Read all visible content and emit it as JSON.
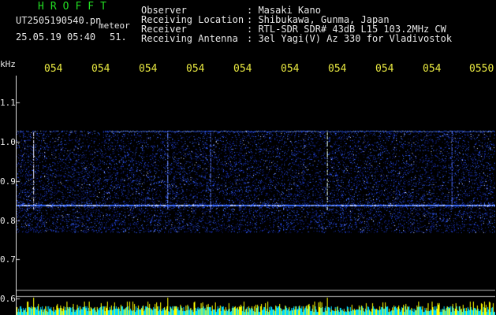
{
  "header": {
    "title": "HROFFT",
    "filename": "UT2505190540.pn",
    "meteor_label": "meteor",
    "datetime": "25.05.19 05:40",
    "count": "51."
  },
  "info": [
    {
      "label": "Observer",
      "value": ": Masaki Kano"
    },
    {
      "label": "Receiving Location",
      "value": ": Shibukawa, Gunma, Japan"
    },
    {
      "label": "Receiver",
      "value": ": RTL-SDR SDR# 43dB L15 103.2MHz CW"
    },
    {
      "label": "Receiving Antenna",
      "value": ": 3el Yagi(V) Az 330 for Vladivostok"
    }
  ],
  "axis": {
    "unit": "kHz",
    "y_ticks": [
      "1.1",
      "1.0",
      "0.9",
      "0.8",
      "0.7",
      "0.6"
    ],
    "x_ticks": [
      "054",
      "054",
      "054",
      "054",
      "054",
      "054",
      "054",
      "054",
      "054",
      "0550"
    ]
  },
  "colors": {
    "text_green": "#22dd22",
    "text_yellow": "#e8e840",
    "signal": "#3a6cff",
    "hot": "#e8e8ff",
    "noise_floor": "#00d8ff",
    "spike": "#ffff00"
  }
}
